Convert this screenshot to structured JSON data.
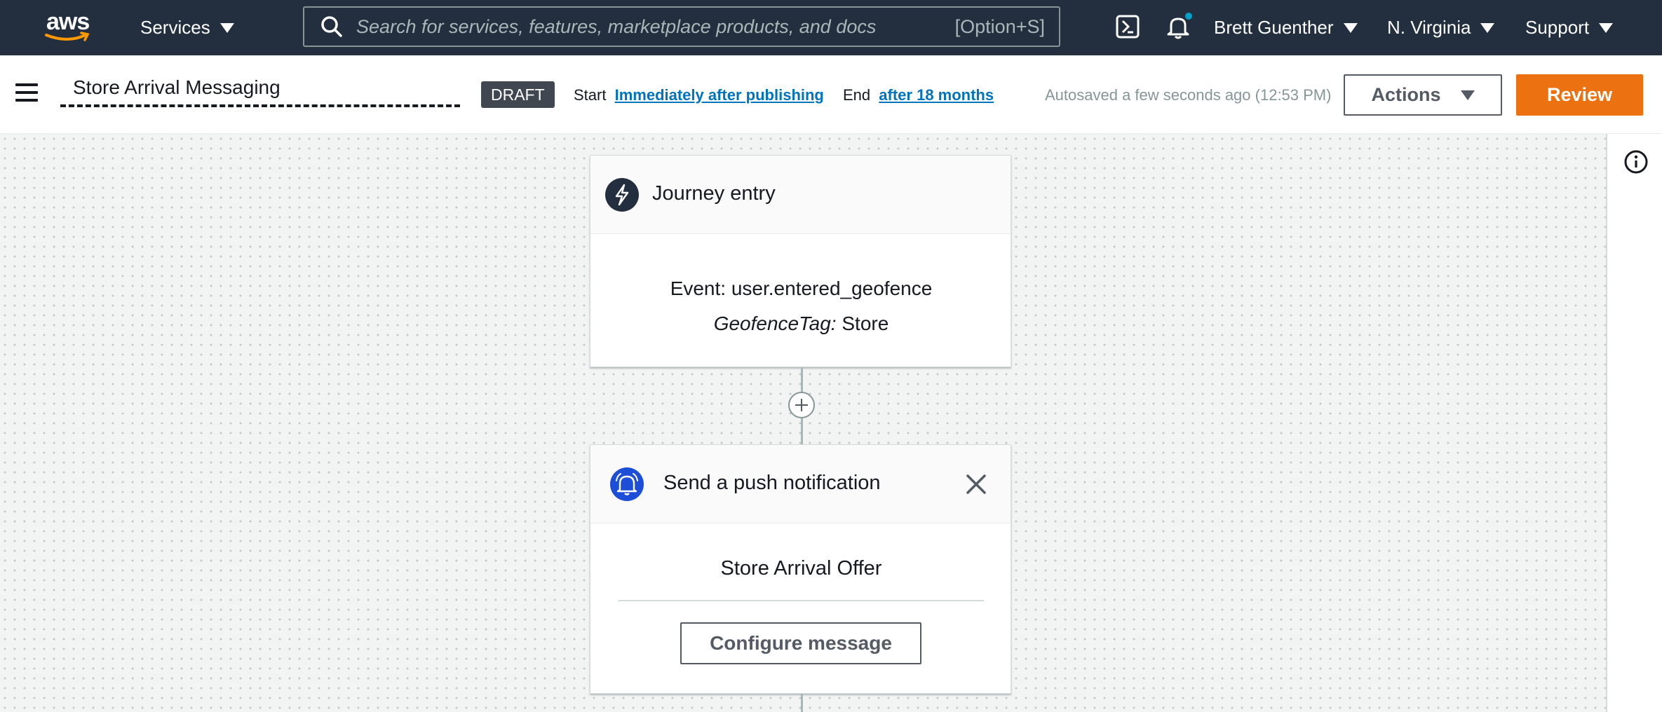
{
  "topnav": {
    "logo_text": "aws",
    "services_label": "Services",
    "search_placeholder": "Search for services, features, marketplace products, and docs",
    "search_shortcut": "[Option+S]",
    "user_label": "Brett Guenther",
    "region_label": "N. Virginia",
    "support_label": "Support"
  },
  "header": {
    "journey_name": "Store Arrival Messaging",
    "status_badge": "DRAFT",
    "start_label": "Start",
    "start_value": "Immediately after publishing",
    "end_label": "End",
    "end_value": "after 18 months",
    "autosaved": "Autosaved a few seconds ago (12:53 PM)",
    "actions_label": "Actions",
    "review_label": "Review"
  },
  "canvas": {
    "entry": {
      "title": "Journey entry",
      "event_line": "Event: user.entered_geofence",
      "attr_key": "GeofenceTag:",
      "attr_value": "Store"
    },
    "push": {
      "title": "Send a push notification",
      "message_name": "Store Arrival Offer",
      "configure_label": "Configure message"
    }
  },
  "colors": {
    "nav_bg": "#232f3e",
    "accent_orange": "#ec7211",
    "link_blue": "#0073bb",
    "push_icon_blue": "#1d4ed8",
    "entry_icon_dark": "#232f3e"
  }
}
